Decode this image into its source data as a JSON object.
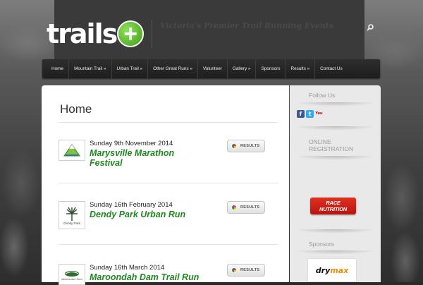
{
  "header": {
    "logo_text": "trails",
    "logo_plus": "+",
    "tagline": "Victoria's Premier Trail Running Events"
  },
  "nav": [
    {
      "label": "Home"
    },
    {
      "label": "Mountain Trail »"
    },
    {
      "label": "Urban Trail »"
    },
    {
      "label": "Other Great Runs »"
    },
    {
      "label": "Volunteer"
    },
    {
      "label": "Gallery »"
    },
    {
      "label": "Sponsors"
    },
    {
      "label": "Results »"
    },
    {
      "label": "Contact Us"
    }
  ],
  "main": {
    "title": "Home",
    "events": [
      {
        "date": "Sunday 9th November 2014",
        "name": "Marysville Marathon Festival",
        "button": "RESULTS"
      },
      {
        "date": "Sunday 16th February 2014",
        "name": "Dendy Park Urban Run",
        "button": "RESULTS",
        "thumb_text": "Dendy Park"
      },
      {
        "date": "Sunday 16th March 2014",
        "name": "Maroondah Dam Trail Run",
        "button": "RESULTS",
        "thumb_text": "Maroondah Dam"
      }
    ]
  },
  "sidebar": {
    "follow_heading": "Follow Us",
    "registration_heading": "ONLINE REGISTRATION",
    "race_nutrition_line1": "RACE",
    "race_nutrition_line2": "NUTRITION",
    "sponsors_heading": "Sponsors",
    "sponsor_logo_a": "dry",
    "sponsor_logo_b": "max",
    "social": [
      "f",
      "t",
      "You"
    ]
  },
  "colors": {
    "accent_green": "#1f8a1f",
    "nav_bg": "#1e1e1e",
    "sidebar_bg": "#e9e9e9"
  }
}
